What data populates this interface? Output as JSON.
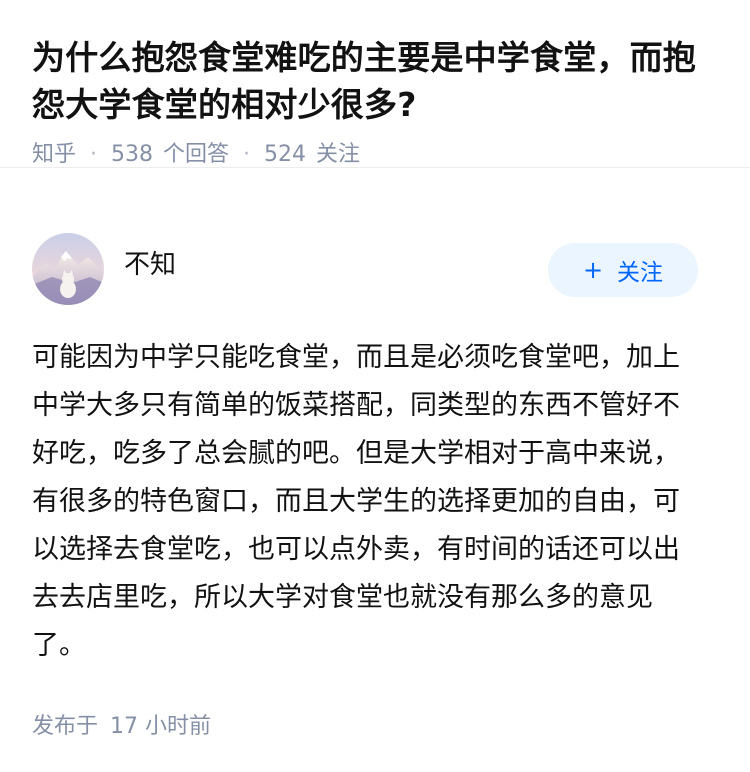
{
  "question": {
    "title": "为什么抱怨食堂难吃的主要是中学食堂，而抱怨大学食堂的相对少很多?",
    "meta": {
      "source": "知乎",
      "answer_count": "538",
      "answer_label": "个回答",
      "follow_count": "524",
      "follow_label": "关注"
    }
  },
  "answer": {
    "author": {
      "name": "不知",
      "avatar_icon": "avatar-mountain-cat-icon"
    },
    "follow_button": {
      "plus": "+",
      "label": "关注"
    },
    "content": "可能因为中学只能吃食堂，而且是必须吃食堂吧，加上中学大多只有简单的饭菜搭配，同类型的东西不管好不好吃，吃多了总会腻的吧。但是大学相对于高中来说，有很多的特色窗口，而且大学生的选择更加的自由，可以选择去食堂吃，也可以点外卖，有时间的话还可以出去去店里吃，所以大学对食堂也就没有那么多的意见了。",
    "time": {
      "prefix": "发布于",
      "value": "17 小时前"
    }
  },
  "colors": {
    "meta_gray": "#8590a6",
    "brand_blue": "#0066ff",
    "follow_bg": "#ebf5ff"
  }
}
